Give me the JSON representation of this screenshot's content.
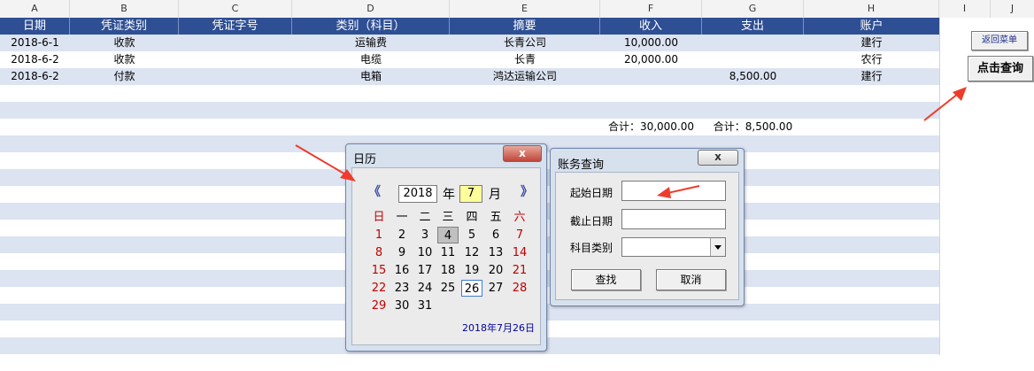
{
  "columns": [
    "A",
    "B",
    "C",
    "D",
    "E",
    "F",
    "G",
    "H",
    "I",
    "J"
  ],
  "table": {
    "headers": [
      "日期",
      "凭证类别",
      "凭证字号",
      "类别（科目）",
      "摘要",
      "收入",
      "支出",
      "账户"
    ],
    "rows": [
      [
        "2018-6-1",
        "收款",
        "",
        "运输费",
        "长青公司",
        "10,000.00",
        "",
        "建行"
      ],
      [
        "2018-6-2",
        "收款",
        "",
        "电缆",
        "长青",
        "20,000.00",
        "",
        "农行"
      ],
      [
        "2018-6-2",
        "付款",
        "",
        "电箱",
        "鸿达运输公司",
        "",
        "8,500.00",
        "建行"
      ]
    ],
    "total_income": "合计：30,000.00",
    "total_expense": "合计：8,500.00"
  },
  "buttons": {
    "return_menu": "返回菜单",
    "click_query": "点击查询"
  },
  "calendar": {
    "title": "日历",
    "close": "x",
    "prev": "《",
    "next": "》",
    "year": "2018",
    "year_unit": "年",
    "month": "7",
    "month_unit": "月",
    "weekdays": [
      "日",
      "一",
      "二",
      "三",
      "四",
      "五",
      "六"
    ],
    "weeks": [
      [
        "1",
        "2",
        "3",
        "4",
        "5",
        "6",
        "7"
      ],
      [
        "8",
        "9",
        "10",
        "11",
        "12",
        "13",
        "14"
      ],
      [
        "15",
        "16",
        "17",
        "18",
        "19",
        "20",
        "21"
      ],
      [
        "22",
        "23",
        "24",
        "25",
        "26",
        "27",
        "28"
      ],
      [
        "29",
        "30",
        "31",
        "",
        "",
        "",
        ""
      ]
    ],
    "today_highlight": "4",
    "selected_day": "26",
    "selected_date_text": "2018年7月26日",
    "weekend_color": "#c00000",
    "footer_color": "#0000a0"
  },
  "query_dialog": {
    "title": "账务查询",
    "start_date_label": "起始日期",
    "end_date_label": "截止日期",
    "category_label": "科目类别",
    "find_button": "查找",
    "cancel_button": "取消"
  },
  "colors": {
    "header_bg": "#2e4f94",
    "band": "#dce3f1",
    "arrow": "#ef3b2c"
  }
}
